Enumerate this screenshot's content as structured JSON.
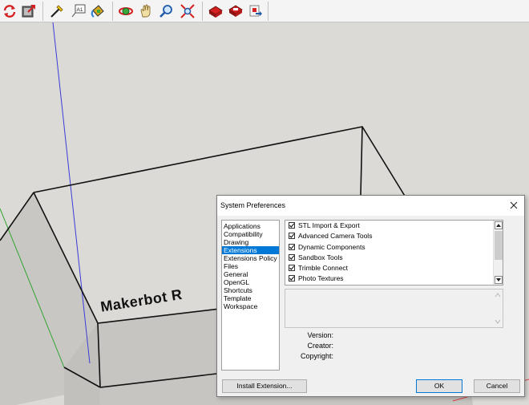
{
  "toolbar": {
    "icons": [
      "reload-icon",
      "export-icon",
      "tape-measure-icon",
      "text-label-icon",
      "paint-bucket-icon",
      "orbit-icon",
      "pan-hand-icon",
      "zoom-icon",
      "zoom-extents-icon",
      "warehouse-icon",
      "extension-warehouse-icon",
      "share-model-icon"
    ]
  },
  "canvas": {
    "model_text": "Makerbot R"
  },
  "dialog": {
    "title": "System Preferences",
    "categories": [
      "Applications",
      "Compatibility",
      "Drawing",
      "Extensions",
      "Extensions Policy",
      "Files",
      "General",
      "OpenGL",
      "Shortcuts",
      "Template",
      "Workspace"
    ],
    "selected_category": "Extensions",
    "extensions": [
      {
        "name": "STL Import & Export",
        "checked": true
      },
      {
        "name": "Advanced Camera Tools",
        "checked": true
      },
      {
        "name": "Dynamic Components",
        "checked": true
      },
      {
        "name": "Sandbox Tools",
        "checked": true
      },
      {
        "name": "Trimble Connect",
        "checked": true
      },
      {
        "name": "Photo Textures",
        "checked": true
      }
    ],
    "version_label": "Version:",
    "creator_label": "Creator:",
    "copyright_label": "Copyright:",
    "install_button": "Install Extension...",
    "ok_button": "OK",
    "cancel_button": "Cancel"
  },
  "colors": {
    "selection": "#0078d7",
    "axis_blue": "#3b3bd8",
    "axis_green": "#2fa52f",
    "axis_red": "#e04545"
  }
}
